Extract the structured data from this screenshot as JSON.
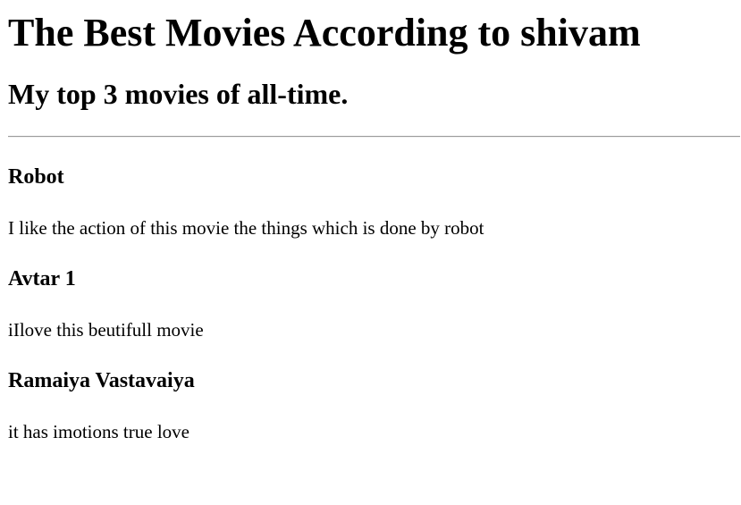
{
  "header": {
    "title": "The Best Movies According to shivam",
    "subtitle": "My top 3 movies of all-time."
  },
  "movies": [
    {
      "title": "Robot",
      "description": "I like the action of this movie the things which is done by robot"
    },
    {
      "title": "Avtar 1",
      "description": "iIlove this beutifull movie"
    },
    {
      "title": "Ramaiya Vastavaiya",
      "description": "it has imotions true love"
    }
  ]
}
